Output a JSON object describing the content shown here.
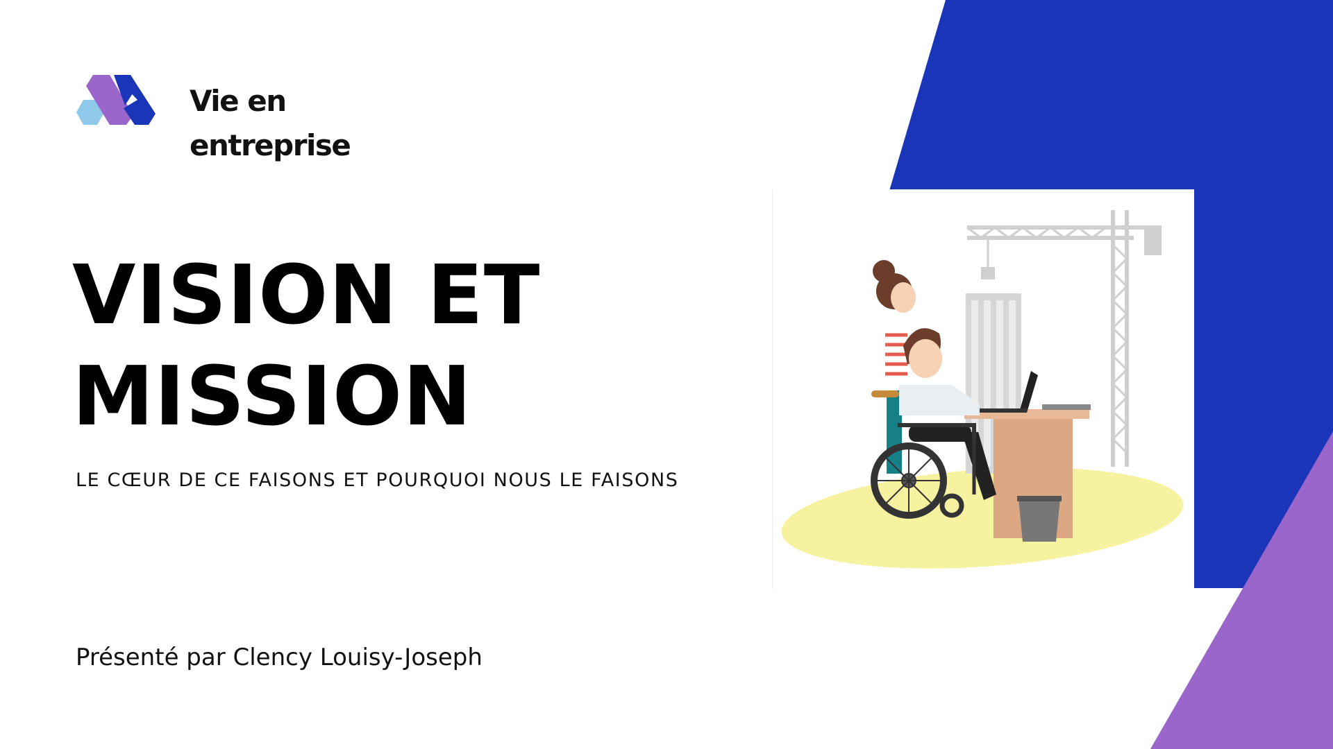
{
  "brand": {
    "line1": "Vie en",
    "line2": "entreprise",
    "logo_icon": "hexagon-m-logo-icon"
  },
  "title": {
    "line1": "VISION ET",
    "line2": "MISSION"
  },
  "subtitle": "LE CŒUR DE CE FAISONS ET POURQUOI NOUS LE FAISONS",
  "presenter": "Présenté par Clency Louisy-Joseph",
  "illustration": {
    "subject": "wheelchair-office-worker-illustration"
  },
  "colors": {
    "blue": "#1a35b8",
    "purple": "#9b66cc",
    "light_blue": "#8fc9ec",
    "text": "#000000",
    "floor_yellow": "#f6f29f",
    "desk": "#dca883"
  }
}
